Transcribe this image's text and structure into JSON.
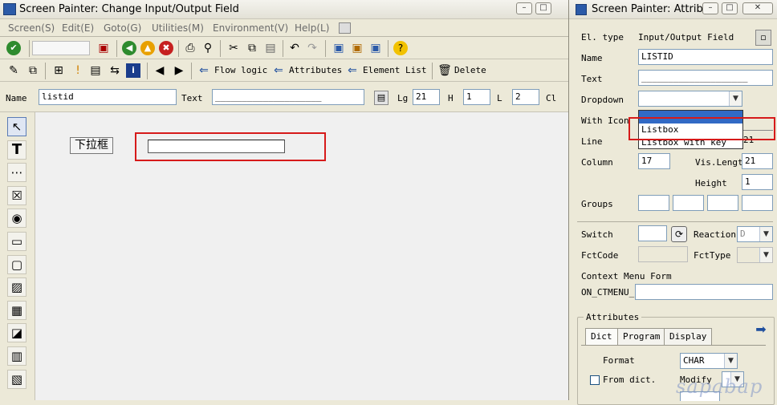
{
  "main": {
    "title": "Screen Painter:  Change Input/Output Field",
    "menu": [
      "Screen(S)",
      "Edit(E)",
      "Goto(G)",
      "Utilities(M)",
      "Environment(V)",
      "Help(L)"
    ],
    "toolbar2": {
      "flow_logic": "Flow logic",
      "attributes": "Attributes",
      "element_list": "Element List",
      "delete": "Delete"
    },
    "fieldbar": {
      "name_label": "Name",
      "name_value": "listid",
      "text_label": "Text",
      "text_value": "____________________",
      "lg_label": "Lg",
      "lg_value": "21",
      "h_label": "H",
      "h_value": "1",
      "l_label": "L",
      "l_value": "2",
      "cl_label": "Cl"
    },
    "canvas": {
      "label_text": "下拉框"
    },
    "palette_icons": [
      "pointer-icon",
      "text-icon",
      "input-field-icon",
      "checkbox-icon",
      "radio-icon",
      "pushbutton-icon",
      "frame-icon",
      "subscreen-icon",
      "tabstrip-icon",
      "custom-control-icon",
      "table-control-icon",
      "table-wizard-icon"
    ]
  },
  "side": {
    "title": "Screen Painter: Attrib...",
    "el_type_label": "El. type",
    "el_type_value": "Input/Output Field",
    "name_label": "Name",
    "name_value": "LISTID",
    "text_label": "Text",
    "text_value": "____________________",
    "dropdown_label": "Dropdown",
    "dropdown_options": [
      "",
      "Listbox",
      "Listbox with key"
    ],
    "with_icon_label": "With Icon",
    "line_label": "Line",
    "line_value": "21",
    "column_label": "Column",
    "column_value": "17",
    "vis_length_label": "Vis.Lengt",
    "vis_length_value": "21",
    "height_label": "Height",
    "height_value": "1",
    "groups_label": "Groups",
    "switch_label": "Switch",
    "reaction_label": "Reaction",
    "reaction_value": "D",
    "fctcode_label": "FctCode",
    "fcttype_label": "FctType",
    "context_menu_label": "Context Menu Form",
    "on_ctmenu_label": "ON_CTMENU_",
    "attributes_group": "Attributes",
    "tabs": [
      "Dict",
      "Program",
      "Display"
    ],
    "format_label": "Format",
    "format_value": "CHAR",
    "from_dict_label": "From dict.",
    "modify_label": "Modify"
  },
  "watermark": "sapabap",
  "colors": {
    "highlight": "#d61a1a",
    "selection": "#316ac5"
  }
}
